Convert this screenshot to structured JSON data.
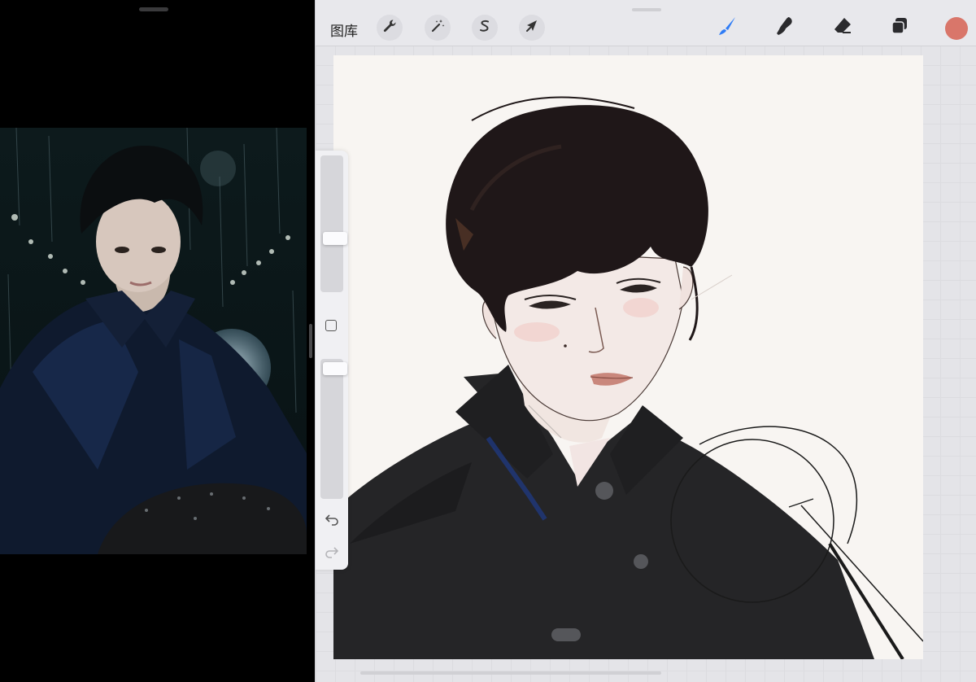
{
  "left_pane": {
    "reference_image": "reference-photo"
  },
  "toolbar": {
    "gallery_label": "图库",
    "left_tools": [
      {
        "name": "actions",
        "icon": "wrench-icon"
      },
      {
        "name": "adjustments",
        "icon": "magic-wand-icon"
      },
      {
        "name": "selection",
        "icon": "selection-s-icon"
      },
      {
        "name": "transform",
        "icon": "arrow-cursor-icon"
      }
    ],
    "right_tools": [
      {
        "name": "brush",
        "icon": "brush-icon",
        "active": true
      },
      {
        "name": "smudge",
        "icon": "smudge-icon"
      },
      {
        "name": "eraser",
        "icon": "eraser-icon"
      },
      {
        "name": "layers",
        "icon": "layers-icon"
      }
    ],
    "current_color": "#d9766a",
    "accent_color": "#2f7cf6"
  },
  "sidebar": {
    "brush_size_level": 0.6,
    "opacity_level": 0.95,
    "controls": [
      "brush-size-slider",
      "modify-button",
      "opacity-slider",
      "undo-button",
      "redo-button"
    ]
  },
  "canvas": {
    "background": "#f8f5f2",
    "subject": "digital-portrait-illustration"
  }
}
